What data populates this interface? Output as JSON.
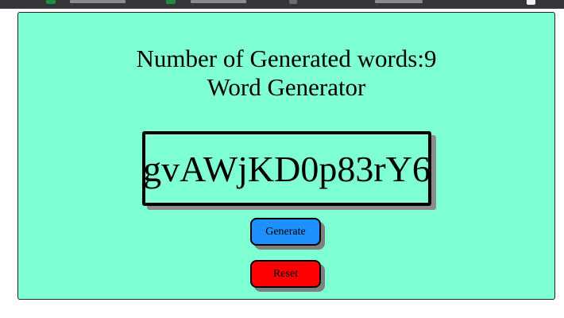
{
  "app": {
    "count_label": "Number of Generated words:",
    "count_value": "9",
    "title": "Word Generator"
  },
  "word": {
    "value": "gvAWjKD0p83rY6"
  },
  "buttons": {
    "generate_label": "Generate",
    "reset_label": "Reset"
  },
  "colors": {
    "card_background": "#7fffd4",
    "generate_button": "#1e90ff",
    "reset_button": "#ff0000",
    "browser_strip": "#35363a"
  }
}
